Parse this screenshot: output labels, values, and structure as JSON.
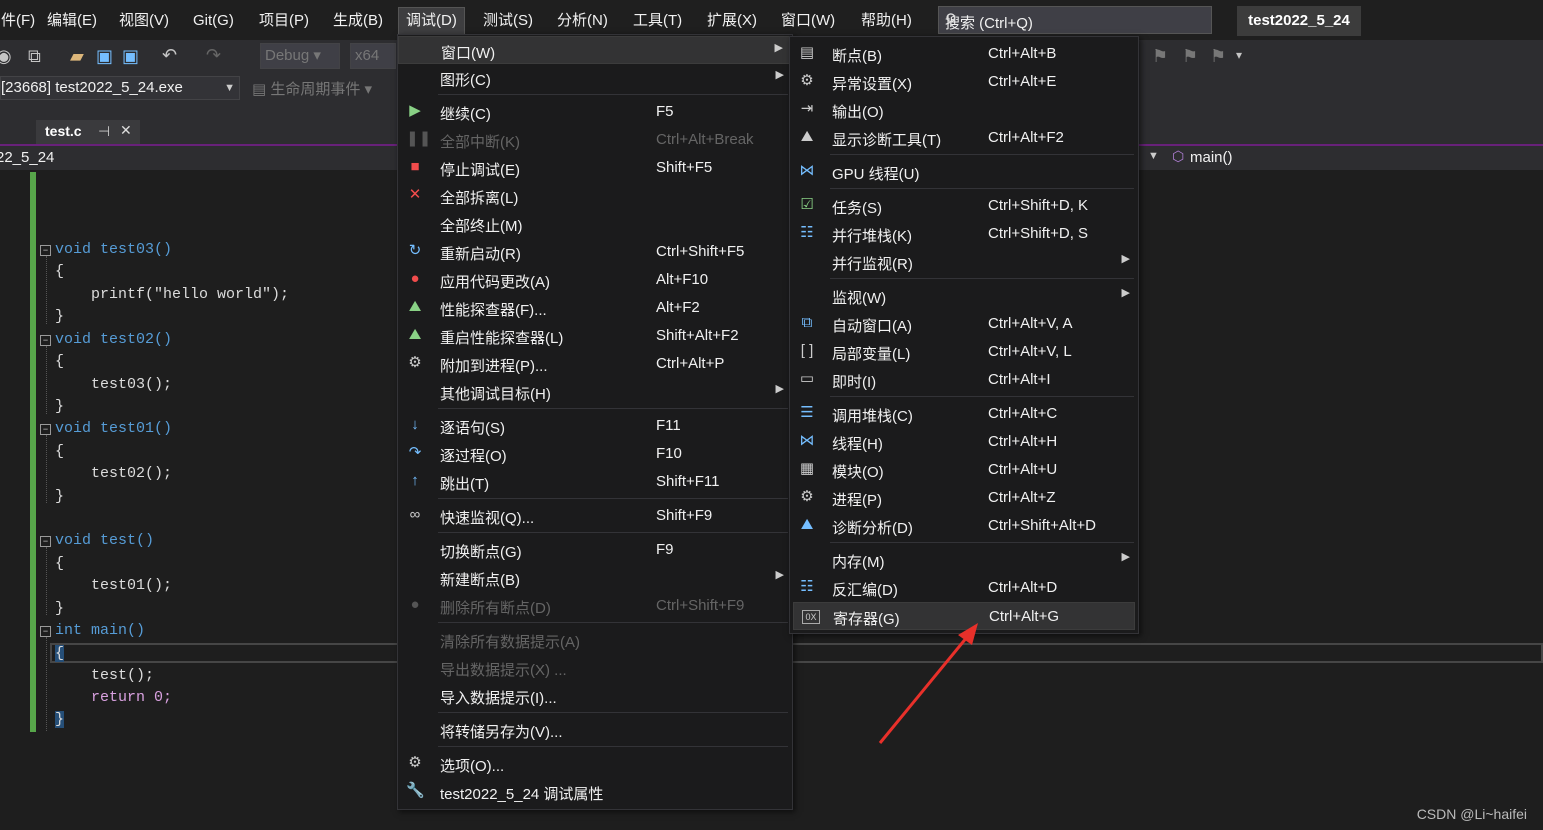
{
  "menubar": {
    "items": [
      "件(F)",
      "编辑(E)",
      "视图(V)",
      "Git(G)",
      "项目(P)",
      "生成(B)",
      "调试(D)",
      "测试(S)",
      "分析(N)",
      "工具(T)",
      "扩展(X)",
      "窗口(W)",
      "帮助(H)"
    ],
    "search_placeholder": "搜索 (Ctrl+Q)",
    "project_title": "test2022_5_24"
  },
  "toolbar": {
    "config": "Debug",
    "platform": "x64",
    "process": "[23668] test2022_5_24.exe",
    "lifecycle": "生命周期事件"
  },
  "tab": {
    "label": "test.c",
    "pin": "⊣",
    "close": "✕"
  },
  "navbar": {
    "left": "22_5_24",
    "right": "main()"
  },
  "code": {
    "l1": "void test03()",
    "l2": "{",
    "l3": "printf(\"hello world\");",
    "l4": "}",
    "l5": "void test02()",
    "l6": "{",
    "l7": "test03();",
    "l8": "}",
    "l9": "void test01()",
    "l10": "{",
    "l11": "test02();",
    "l12": "}",
    "l13": "void test()",
    "l14": "{",
    "l15": "test01();",
    "l16": "}",
    "l17": "int main()",
    "l18": "{",
    "l19": "test();",
    "l20": "return 0;",
    "l21": "}"
  },
  "debug_menu": {
    "items": [
      {
        "label": "窗口(W)",
        "shortcut": "",
        "submenu": true
      },
      {
        "label": "图形(C)",
        "shortcut": "",
        "submenu": true
      },
      {
        "label": "继续(C)",
        "shortcut": "F5"
      },
      {
        "label": "全部中断(K)",
        "shortcut": "Ctrl+Alt+Break",
        "disabled": true
      },
      {
        "label": "停止调试(E)",
        "shortcut": "Shift+F5"
      },
      {
        "label": "全部拆离(L)",
        "shortcut": ""
      },
      {
        "label": "全部终止(M)",
        "shortcut": ""
      },
      {
        "label": "重新启动(R)",
        "shortcut": "Ctrl+Shift+F5"
      },
      {
        "label": "应用代码更改(A)",
        "shortcut": "Alt+F10"
      },
      {
        "label": "性能探查器(F)...",
        "shortcut": "Alt+F2"
      },
      {
        "label": "重启性能探查器(L)",
        "shortcut": "Shift+Alt+F2"
      },
      {
        "label": "附加到进程(P)...",
        "shortcut": "Ctrl+Alt+P"
      },
      {
        "label": "其他调试目标(H)",
        "shortcut": "",
        "submenu": true
      },
      {
        "label": "逐语句(S)",
        "shortcut": "F11"
      },
      {
        "label": "逐过程(O)",
        "shortcut": "F10"
      },
      {
        "label": "跳出(T)",
        "shortcut": "Shift+F11"
      },
      {
        "label": "快速监视(Q)...",
        "shortcut": "Shift+F9"
      },
      {
        "label": "切换断点(G)",
        "shortcut": "F9"
      },
      {
        "label": "新建断点(B)",
        "shortcut": "",
        "submenu": true
      },
      {
        "label": "删除所有断点(D)",
        "shortcut": "Ctrl+Shift+F9",
        "disabled": true
      },
      {
        "label": "清除所有数据提示(A)",
        "shortcut": "",
        "disabled": true
      },
      {
        "label": "导出数据提示(X) ...",
        "shortcut": "",
        "disabled": true
      },
      {
        "label": "导入数据提示(I)...",
        "shortcut": ""
      },
      {
        "label": "将转储另存为(V)...",
        "shortcut": ""
      },
      {
        "label": "选项(O)...",
        "shortcut": ""
      },
      {
        "label": "test2022_5_24 调试属性",
        "shortcut": ""
      }
    ]
  },
  "window_submenu": {
    "items": [
      {
        "label": "断点(B)",
        "shortcut": "Ctrl+Alt+B"
      },
      {
        "label": "异常设置(X)",
        "shortcut": "Ctrl+Alt+E"
      },
      {
        "label": "输出(O)",
        "shortcut": ""
      },
      {
        "label": "显示诊断工具(T)",
        "shortcut": "Ctrl+Alt+F2"
      },
      {
        "label": "GPU 线程(U)",
        "shortcut": ""
      },
      {
        "label": "任务(S)",
        "shortcut": "Ctrl+Shift+D, K"
      },
      {
        "label": "并行堆栈(K)",
        "shortcut": "Ctrl+Shift+D, S"
      },
      {
        "label": "并行监视(R)",
        "shortcut": "",
        "submenu": true
      },
      {
        "label": "监视(W)",
        "shortcut": "",
        "submenu": true
      },
      {
        "label": "自动窗口(A)",
        "shortcut": "Ctrl+Alt+V, A"
      },
      {
        "label": "局部变量(L)",
        "shortcut": "Ctrl+Alt+V, L"
      },
      {
        "label": "即时(I)",
        "shortcut": "Ctrl+Alt+I"
      },
      {
        "label": "调用堆栈(C)",
        "shortcut": "Ctrl+Alt+C"
      },
      {
        "label": "线程(H)",
        "shortcut": "Ctrl+Alt+H"
      },
      {
        "label": "模块(O)",
        "shortcut": "Ctrl+Alt+U"
      },
      {
        "label": "进程(P)",
        "shortcut": "Ctrl+Alt+Z"
      },
      {
        "label": "诊断分析(D)",
        "shortcut": "Ctrl+Shift+Alt+D"
      },
      {
        "label": "内存(M)",
        "shortcut": "",
        "submenu": true
      },
      {
        "label": "反汇编(D)",
        "shortcut": "Ctrl+Alt+D"
      },
      {
        "label": "寄存器(G)",
        "shortcut": "Ctrl+Alt+G",
        "highlighted": true
      }
    ]
  },
  "watermark": "CSDN @Li~haifei"
}
